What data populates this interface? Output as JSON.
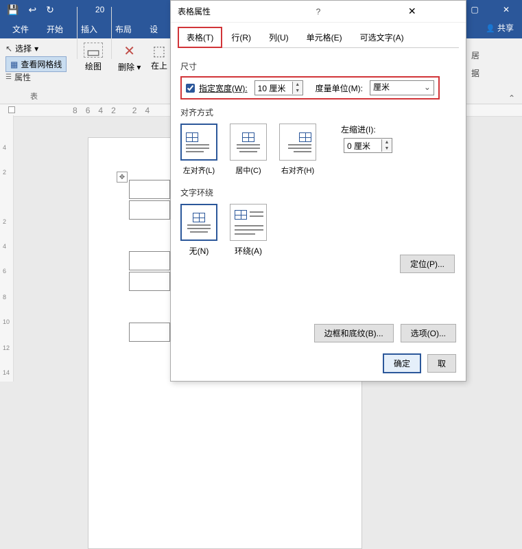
{
  "word": {
    "doc_title": "20",
    "tabs": {
      "file": "文件",
      "home": "开始",
      "insert": "插入",
      "layout": "布局",
      "design": "设"
    },
    "share": "共享",
    "ribbon": {
      "select": "选择",
      "view_gridlines": "查看网格线",
      "properties": "属性",
      "group_table": "表",
      "draw": "绘图",
      "delete": "删除",
      "insert_above": "在上",
      "right_frag": "居",
      "right_frag2": "据"
    },
    "ruler_h": [
      "8",
      "6",
      "4",
      "2",
      "",
      "2",
      "4"
    ]
  },
  "dialog": {
    "title": "表格属性",
    "tabs": {
      "table": "表格(T)",
      "row": "行(R)",
      "column": "列(U)",
      "cell": "单元格(E)",
      "alt": "可选文字(A)"
    },
    "size": {
      "section": "尺寸",
      "specify_width": "指定宽度(W):",
      "width_value": "10 厘米",
      "unit_label": "度量单位(M):",
      "unit_value": "厘米"
    },
    "align": {
      "section": "对齐方式",
      "left": "左对齐(L)",
      "center": "居中(C)",
      "right": "右对齐(H)",
      "indent_label": "左缩进(I):",
      "indent_value": "0 厘米"
    },
    "wrap": {
      "section": "文字环绕",
      "none": "无(N)",
      "around": "环绕(A)",
      "position": "定位(P)..."
    },
    "footer": {
      "borders": "边框和底纹(B)...",
      "options": "选项(O)...",
      "ok": "确定",
      "cancel": "取"
    }
  }
}
